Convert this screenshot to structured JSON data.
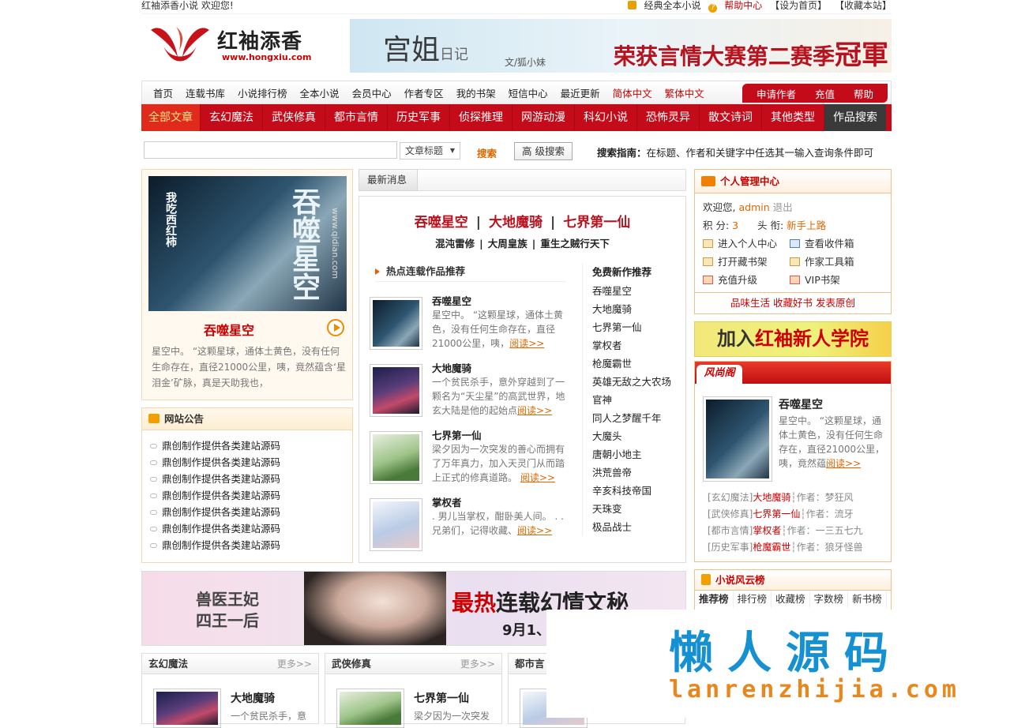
{
  "topbar": {
    "welcome": "红袖添香小说  欢迎您!",
    "links": [
      "经典全本小说",
      "帮助中心",
      "【设为首页】",
      "【收藏本站】"
    ]
  },
  "logo": {
    "name": "红袖添香",
    "url": "www.hongxiu.com"
  },
  "top_banner": {
    "title": "宫姐",
    "title_small": "日记",
    "author": "文/狐小妹",
    "slogan": "荣获言情大赛第二赛季",
    "slogan_big": "冠軍"
  },
  "nav_main": [
    "首页",
    "连载书库",
    "小说排行榜",
    "全本小说",
    "会员中心",
    "作者专区",
    "我的书架",
    "短信中心",
    "最近更新",
    "简体中文",
    "繁体中文"
  ],
  "nav_right": [
    "申请作者",
    "充值",
    "帮助"
  ],
  "nav_categories": [
    "全部文章",
    "玄幻魔法",
    "武侠修真",
    "都市言情",
    "历史军事",
    "侦探推理",
    "网游动漫",
    "科幻小说",
    "恐怖灵异",
    "散文诗词",
    "其他类型",
    "作品搜索"
  ],
  "search": {
    "select_value": "文章标题",
    "search_label": "搜索",
    "advanced_label": "高 级搜索",
    "guide_label": "搜索指南：",
    "guide_text": "在标题、作者和关键字中任选其一输入查询条件即可"
  },
  "feature": {
    "cover_text": "吞噬星空",
    "cover_small": "我吃西红柿",
    "cover_url": "www.qidian.com",
    "title": "吞噬星空",
    "desc": "星空中。 “这颗星球，通体土黄色，没有任何生命存在，直径21000公里，咦，竟然蕴含‘星泪金’矿脉，真是天助我也，"
  },
  "notice": {
    "title": "网站公告",
    "items": [
      "鼎创制作提供各类建站源码",
      "鼎创制作提供各类建站源码",
      "鼎创制作提供各类建站源码",
      "鼎创制作提供各类建站源码",
      "鼎创制作提供各类建站源码",
      "鼎创制作提供各类建站源码",
      "鼎创制作提供各类建站源码"
    ]
  },
  "middle": {
    "tab": "最新消息",
    "hot_links": [
      "吞噬星空",
      "大地魔骑",
      "七界第一仙"
    ],
    "sub_links": [
      "混沌雷修",
      "大周皇族",
      "重生之贼行天下"
    ],
    "rec_title": "热点连载作品推荐",
    "read_label": "阅读>>",
    "items": [
      {
        "title": "吞噬星空",
        "desc": "星空中。 “这颗星球，通体土黄色，没有任何生命存在，直径21000公里，咦，"
      },
      {
        "title": "大地魔骑",
        "desc": "一个贫民杀手，意外穿越到了一颗名为“天尘星”的高武世界，地玄大陆是他的起始点"
      },
      {
        "title": "七界第一仙",
        "desc": "梁夕因为一次突发的善心而拥有了万年真力，加入天灵门从而踏上正式的修真道路。 "
      },
      {
        "title": "掌权者",
        "desc": ".  男儿当掌权，酣卧美人间。 .  . 兄弟们，记得收藏、"
      }
    ],
    "free_title": "免费新作推荐",
    "free_list": [
      "吞噬星空",
      "大地魔骑",
      "七界第一仙",
      "掌权者",
      "枪魔霸世",
      "英雄无敌之大农场",
      "官神",
      "同人之梦醒千年",
      "大魔头",
      "唐朝小地主",
      "洪荒兽帝",
      "辛亥科技帝国",
      "天珠变",
      "极品战士"
    ]
  },
  "user": {
    "title": "个人管理中心",
    "welcome": "欢迎您,",
    "username": "admin",
    "logout": "退出",
    "points_label": "积  分:",
    "points": "3",
    "rank_label": "头  衔:",
    "rank": "新手上路",
    "links": [
      "进入个人中心",
      "查看收件箱",
      "打开藏书架",
      "作家工具箱",
      "充值升级",
      "VIP书架"
    ],
    "footer": "品味生活 收藏好书 发表原创"
  },
  "join_banner": {
    "text1": "加入",
    "text2": "红袖新人学院"
  },
  "pic_box": {
    "tab": "风尚阁",
    "title": "吞噬星空",
    "desc": "星空中。 “这颗星球，通体土黄色，没有任何生命存在，直径21000公里，咦，竟然蕴",
    "read": "阅读>>",
    "list": [
      {
        "cat": "[玄幻魔法]",
        "book": "大地魔骑",
        "author": "┆作者：梦狂风"
      },
      {
        "cat": "[武侠修真]",
        "book": "七界第一仙",
        "author": "┆作者：流牙"
      },
      {
        "cat": "[都市言情]",
        "book": "掌权者",
        "author": "┆作者：一三五七九"
      },
      {
        "cat": "[历史军事]",
        "book": "枪魔霸世",
        "author": "┆作者：狼牙怪兽"
      }
    ]
  },
  "rank": {
    "title": "小说风云榜",
    "tabs": [
      "推荐榜",
      "排行榜",
      "收藏榜",
      "字数榜",
      "新书榜"
    ]
  },
  "bottom_banner": {
    "left": "兽医王妃\n四王一后",
    "hot_red": "最热",
    "hot_rest": "连载幻情文秘",
    "date": "9月1、"
  },
  "cat_boxes": [
    {
      "title": "玄幻魔法",
      "more": "更多>>",
      "book": "大地魔骑",
      "desc": "一个贫民杀手，意"
    },
    {
      "title": "武侠修真",
      "more": "更多>>",
      "book": "七界第一仙",
      "desc": "梁夕因为一次突发"
    },
    {
      "title": "都市言",
      "more": "",
      "book": "",
      "desc": ""
    }
  ],
  "watermark": {
    "big": "懒人源码",
    "small": "lanrenzhijia.com"
  }
}
